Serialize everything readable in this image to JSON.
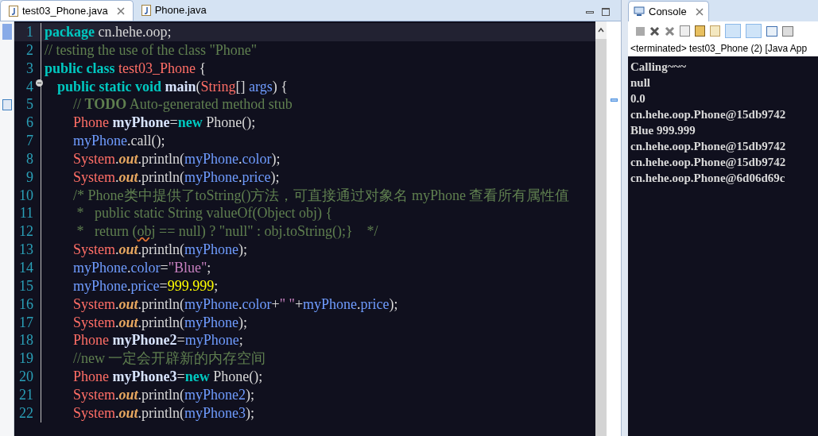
{
  "editor": {
    "tabs": [
      {
        "label": "test03_Phone.java",
        "selected": true
      },
      {
        "label": "Phone.java",
        "selected": false
      }
    ],
    "lines": [
      {
        "number": "1",
        "current": true,
        "tokens": [
          {
            "kind": "kw",
            "text": "package"
          },
          {
            "kind": "plain",
            "text": " cn.hehe.oop;"
          }
        ]
      },
      {
        "number": "2",
        "current": false,
        "tokens": [
          {
            "kind": "comment",
            "text": "// testing the use of the class \"Phone\""
          }
        ]
      },
      {
        "number": "3",
        "current": false,
        "tokens": [
          {
            "kind": "kw",
            "text": "public class "
          },
          {
            "kind": "type",
            "text": "test03_Phone"
          },
          {
            "kind": "plain",
            "text": " {"
          }
        ],
        "children": [
          {
            "number": "4",
            "current": false,
            "folded": false,
            "tokens": [
              {
                "kind": "kw",
                "text": "public static void "
              },
              {
                "kind": "method",
                "text": "main"
              },
              {
                "kind": "plain",
                "text": "("
              },
              {
                "kind": "type",
                "text": "String"
              },
              {
                "kind": "plain",
                "text": "[] "
              },
              {
                "kind": "var",
                "text": "args"
              },
              {
                "kind": "plain",
                "text": ") {"
              }
            ],
            "children": [
              {
                "number": "5",
                "current": false,
                "task": true,
                "tokens": [
                  {
                    "kind": "comment",
                    "text": "// "
                  },
                  {
                    "kind": "todo",
                    "text": "TODO"
                  },
                  {
                    "kind": "comment",
                    "text": " Auto-generated method stub"
                  }
                ]
              },
              {
                "number": "6",
                "current": false,
                "tokens": [
                  {
                    "kind": "type",
                    "text": "Phone "
                  },
                  {
                    "kind": "decl",
                    "text": "myPhone"
                  },
                  {
                    "kind": "plain",
                    "text": "="
                  },
                  {
                    "kind": "kw",
                    "text": "new"
                  },
                  {
                    "kind": "plain",
                    "text": " Phone();"
                  }
                ]
              },
              {
                "number": "7",
                "current": false,
                "tokens": [
                  {
                    "kind": "var",
                    "text": "myPhone"
                  },
                  {
                    "kind": "plain",
                    "text": ".call();"
                  }
                ]
              },
              {
                "number": "8",
                "current": false,
                "tokens": [
                  {
                    "kind": "type",
                    "text": "System"
                  },
                  {
                    "kind": "plain",
                    "text": "."
                  },
                  {
                    "kind": "static",
                    "text": "out"
                  },
                  {
                    "kind": "plain",
                    "text": ".println("
                  },
                  {
                    "kind": "var",
                    "text": "myPhone"
                  },
                  {
                    "kind": "plain",
                    "text": "."
                  },
                  {
                    "kind": "var",
                    "text": "color"
                  },
                  {
                    "kind": "plain",
                    "text": ");"
                  }
                ]
              },
              {
                "number": "9",
                "current": false,
                "tokens": [
                  {
                    "kind": "type",
                    "text": "System"
                  },
                  {
                    "kind": "plain",
                    "text": "."
                  },
                  {
                    "kind": "static",
                    "text": "out"
                  },
                  {
                    "kind": "plain",
                    "text": ".println("
                  },
                  {
                    "kind": "var",
                    "text": "myPhone"
                  },
                  {
                    "kind": "plain",
                    "text": "."
                  },
                  {
                    "kind": "var",
                    "text": "price"
                  },
                  {
                    "kind": "plain",
                    "text": ");"
                  }
                ]
              },
              {
                "number": "10",
                "current": false,
                "tokens": [
                  {
                    "kind": "comment",
                    "text": "/* Phone类中提供了toString()方法，可直接通过对象名 myPhone 查看所有属性值"
                  }
                ]
              },
              {
                "number": "11",
                "current": false,
                "tokens": [
                  {
                    "kind": "comment",
                    "text": " *   public static String valueOf(Object obj) {"
                  }
                ]
              },
              {
                "number": "12",
                "current": false,
                "tokens": [
                  {
                    "kind": "comment",
                    "text": " *   return ("
                  },
                  {
                    "kind": "warning",
                    "text": "obj"
                  },
                  {
                    "kind": "comment",
                    "text": " == null) ? \"null\" : obj.toString();}    */"
                  }
                ]
              },
              {
                "number": "13",
                "current": false,
                "tokens": [
                  {
                    "kind": "type",
                    "text": "System"
                  },
                  {
                    "kind": "plain",
                    "text": "."
                  },
                  {
                    "kind": "static",
                    "text": "out"
                  },
                  {
                    "kind": "plain",
                    "text": ".println("
                  },
                  {
                    "kind": "var",
                    "text": "myPhone"
                  },
                  {
                    "kind": "plain",
                    "text": ");"
                  }
                ]
              },
              {
                "number": "14",
                "current": false,
                "tokens": [
                  {
                    "kind": "var",
                    "text": "myPhone"
                  },
                  {
                    "kind": "plain",
                    "text": "."
                  },
                  {
                    "kind": "var",
                    "text": "color"
                  },
                  {
                    "kind": "plain",
                    "text": "="
                  },
                  {
                    "kind": "str",
                    "text": "\"Blue\""
                  },
                  {
                    "kind": "plain",
                    "text": ";"
                  }
                ]
              },
              {
                "number": "15",
                "current": false,
                "tokens": [
                  {
                    "kind": "var",
                    "text": "myPhone"
                  },
                  {
                    "kind": "plain",
                    "text": "."
                  },
                  {
                    "kind": "var",
                    "text": "price"
                  },
                  {
                    "kind": "plain",
                    "text": "="
                  },
                  {
                    "kind": "num",
                    "text": "999.999"
                  },
                  {
                    "kind": "plain",
                    "text": ";"
                  }
                ]
              },
              {
                "number": "16",
                "current": false,
                "tokens": [
                  {
                    "kind": "type",
                    "text": "System"
                  },
                  {
                    "kind": "plain",
                    "text": "."
                  },
                  {
                    "kind": "static",
                    "text": "out"
                  },
                  {
                    "kind": "plain",
                    "text": ".println("
                  },
                  {
                    "kind": "var",
                    "text": "myPhone"
                  },
                  {
                    "kind": "plain",
                    "text": "."
                  },
                  {
                    "kind": "var",
                    "text": "color"
                  },
                  {
                    "kind": "plain",
                    "text": "+"
                  },
                  {
                    "kind": "str",
                    "text": "\" \""
                  },
                  {
                    "kind": "plain",
                    "text": "+"
                  },
                  {
                    "kind": "var",
                    "text": "myPhone"
                  },
                  {
                    "kind": "plain",
                    "text": "."
                  },
                  {
                    "kind": "var",
                    "text": "price"
                  },
                  {
                    "kind": "plain",
                    "text": ");"
                  }
                ]
              },
              {
                "number": "17",
                "current": false,
                "tokens": [
                  {
                    "kind": "type",
                    "text": "System"
                  },
                  {
                    "kind": "plain",
                    "text": "."
                  },
                  {
                    "kind": "static",
                    "text": "out"
                  },
                  {
                    "kind": "plain",
                    "text": ".println("
                  },
                  {
                    "kind": "var",
                    "text": "myPhone"
                  },
                  {
                    "kind": "plain",
                    "text": ");"
                  }
                ]
              },
              {
                "number": "18",
                "current": false,
                "tokens": [
                  {
                    "kind": "type",
                    "text": "Phone "
                  },
                  {
                    "kind": "decl",
                    "text": "myPhone2"
                  },
                  {
                    "kind": "plain",
                    "text": "="
                  },
                  {
                    "kind": "var",
                    "text": "myPhone"
                  },
                  {
                    "kind": "plain",
                    "text": ";"
                  }
                ]
              },
              {
                "number": "19",
                "current": false,
                "tokens": [
                  {
                    "kind": "comment",
                    "text": "//new 一定会开辟新的内存空间"
                  }
                ]
              },
              {
                "number": "20",
                "current": false,
                "tokens": [
                  {
                    "kind": "type",
                    "text": "Phone "
                  },
                  {
                    "kind": "decl",
                    "text": "myPhone3"
                  },
                  {
                    "kind": "plain",
                    "text": "="
                  },
                  {
                    "kind": "kw",
                    "text": "new"
                  },
                  {
                    "kind": "plain",
                    "text": " Phone();"
                  }
                ]
              },
              {
                "number": "21",
                "current": false,
                "tokens": [
                  {
                    "kind": "type",
                    "text": "System"
                  },
                  {
                    "kind": "plain",
                    "text": "."
                  },
                  {
                    "kind": "static",
                    "text": "out"
                  },
                  {
                    "kind": "plain",
                    "text": ".println("
                  },
                  {
                    "kind": "var",
                    "text": "myPhone2"
                  },
                  {
                    "kind": "plain",
                    "text": ");"
                  }
                ]
              },
              {
                "number": "22",
                "current": false,
                "tokens": [
                  {
                    "kind": "type",
                    "text": "System"
                  },
                  {
                    "kind": "plain",
                    "text": "."
                  },
                  {
                    "kind": "static",
                    "text": "out"
                  },
                  {
                    "kind": "plain",
                    "text": ".println("
                  },
                  {
                    "kind": "var",
                    "text": "myPhone3"
                  },
                  {
                    "kind": "plain",
                    "text": ");"
                  }
                ]
              }
            ]
          }
        ]
      }
    ]
  },
  "console": {
    "tab": {
      "label": "Console",
      "selected": true
    },
    "status": "<terminated> test03_Phone (2) [Java App",
    "output": [
      "Calling~~~",
      "null",
      "0.0",
      "cn.hehe.oop.Phone@15db9742",
      "Blue 999.999",
      "cn.hehe.oop.Phone@15db9742",
      "cn.hehe.oop.Phone@15db9742",
      "cn.hehe.oop.Phone@6d06d69c"
    ]
  }
}
